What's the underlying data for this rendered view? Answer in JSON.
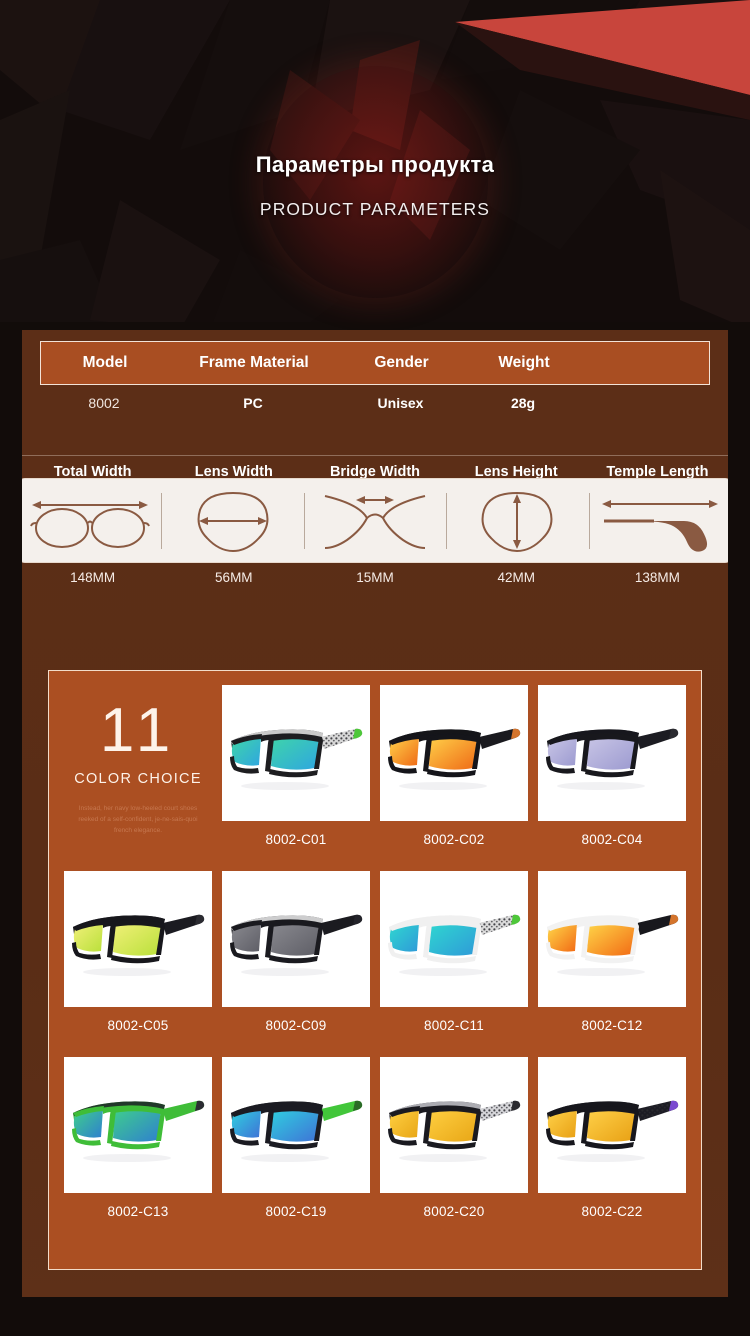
{
  "hero": {
    "title_ru": "Параметры продукта",
    "title_en": "PRODUCT PARAMETERS",
    "accent_red": "#c8453c",
    "background": "#130c0b"
  },
  "spec_table": {
    "headers": [
      "Model",
      "Frame Material",
      "Gender",
      "Weight"
    ],
    "values": [
      "8002",
      "PC",
      "Unisex",
      "28g"
    ],
    "header_bg": "#a94e22",
    "body_bg": "#5a2d16"
  },
  "dimensions": {
    "labels": [
      "Total Width",
      "Lens Width",
      "Bridge Width",
      "Lens Height",
      "Temple Length"
    ],
    "values": [
      "148MM",
      "56MM",
      "15MM",
      "42MM",
      "138MM"
    ],
    "icons": [
      "total-width-icon",
      "lens-width-icon",
      "bridge-width-icon",
      "lens-height-icon",
      "temple-length-icon"
    ],
    "strip_bg": "#f4f0ec",
    "line_color": "#8a5a42"
  },
  "color_choice": {
    "count": "11",
    "subtitle": "COLOR CHOICE",
    "description": "Instead, her navy low-heeled court shoes reeked of a self-confident, je-ne-sais-quoi french elegance.",
    "panel_bg": "#ab4f22",
    "items": [
      {
        "label": "8002-C01",
        "frame": "#1d1d20",
        "frame2": "#e8e8e8",
        "temple": "#d8d8d8",
        "tip": "#4ec73a",
        "lens_a": "#3fd6a8",
        "lens_b": "#2fa6e0",
        "pattern": true
      },
      {
        "label": "8002-C02",
        "frame": "#15151a",
        "frame2": "#15151a",
        "temple": "#1a1a1f",
        "tip": "#d4742c",
        "lens_a": "#ffd24a",
        "lens_b": "#ef6a16",
        "pattern": false
      },
      {
        "label": "8002-C04",
        "frame": "#18181d",
        "frame2": "#18181d",
        "temple": "#1c1c22",
        "tip": "#2a2a30",
        "lens_a": "#c9c6e6",
        "lens_b": "#9c9ad0",
        "pattern": false
      },
      {
        "label": "8002-C05",
        "frame": "#17171c",
        "frame2": "#17171c",
        "temple": "#1b1b21",
        "tip": "#2b2b31",
        "lens_a": "#f2f07a",
        "lens_b": "#b9e03a",
        "pattern": false
      },
      {
        "label": "8002-C09",
        "frame": "#1a1a1f",
        "frame2": "#ededed",
        "temple": "#1b1b20",
        "tip": "#23232a",
        "lens_a": "#8a8a90",
        "lens_b": "#5e5e66",
        "pattern": false
      },
      {
        "label": "8002-C11",
        "frame": "#f0f0f0",
        "frame2": "#f0f0f0",
        "temple": "#dcdcdc",
        "tip": "#4ec73a",
        "lens_a": "#2fd8d0",
        "lens_b": "#2f9ad8",
        "pattern": true
      },
      {
        "label": "8002-C12",
        "frame": "#f2f2f2",
        "frame2": "#f2f2f2",
        "temple": "#18181d",
        "tip": "#d4742c",
        "lens_a": "#ffd94a",
        "lens_b": "#f26a14",
        "pattern": false
      },
      {
        "label": "8002-C13",
        "frame": "#3fbd38",
        "frame2": "#1d2128",
        "temple": "#3fbd38",
        "tip": "#2c2c32",
        "lens_a": "#3fd08a",
        "lens_b": "#2f7fd0",
        "pattern": false
      },
      {
        "label": "8002-C19",
        "frame": "#1b1b22",
        "frame2": "#1b1b22",
        "temple": "#42c63a",
        "tip": "#2a6a26",
        "lens_a": "#2fd2e0",
        "lens_b": "#3f72d6",
        "pattern": false
      },
      {
        "label": "8002-C20",
        "frame": "#1a1a20",
        "frame2": "#c7c7cc",
        "temple": "#d6d6da",
        "tip": "#2a2a30",
        "lens_a": "#ffd042",
        "lens_b": "#e8a616",
        "pattern": true
      },
      {
        "label": "8002-C22",
        "frame": "#17171d",
        "frame2": "#17171d",
        "temple": "#1c1c24",
        "tip": "#7a4ad0",
        "lens_a": "#ffd24a",
        "lens_b": "#e8a014",
        "pattern": true
      }
    ]
  }
}
